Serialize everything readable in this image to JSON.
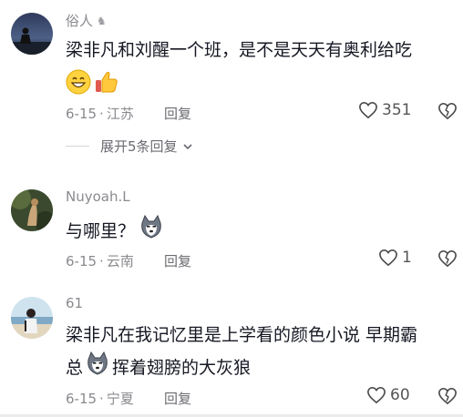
{
  "comments": [
    {
      "name": "俗人",
      "text": "梁非凡和刘醒一个班，是不是天天有奥利给吃",
      "date": "6-15",
      "location": "江苏",
      "reply_label": "回复",
      "likes": "351",
      "emoji": [
        "grin-emoji",
        "thumbs-up-emoji"
      ]
    },
    {
      "name": "Nuyoah.L",
      "text": "与哪里？",
      "date": "6-15",
      "location": "云南",
      "reply_label": "回复",
      "likes": "1",
      "emoji": [
        "husky-emoji"
      ]
    },
    {
      "name": "61",
      "text_line1": "梁非凡在我记忆里是上学看的颜色小说  早期霸",
      "text_line2_a": "总",
      "text_line2_b": "挥着翅膀的大灰狼",
      "date": "6-15",
      "location": "宁夏",
      "reply_label": "回复",
      "likes": "60",
      "emoji": [
        "husky-emoji"
      ]
    }
  ],
  "expand_replies": "展开5条回复",
  "colors": {
    "text": "#161823",
    "meta": "#8a8a8f",
    "like": "#555555"
  }
}
